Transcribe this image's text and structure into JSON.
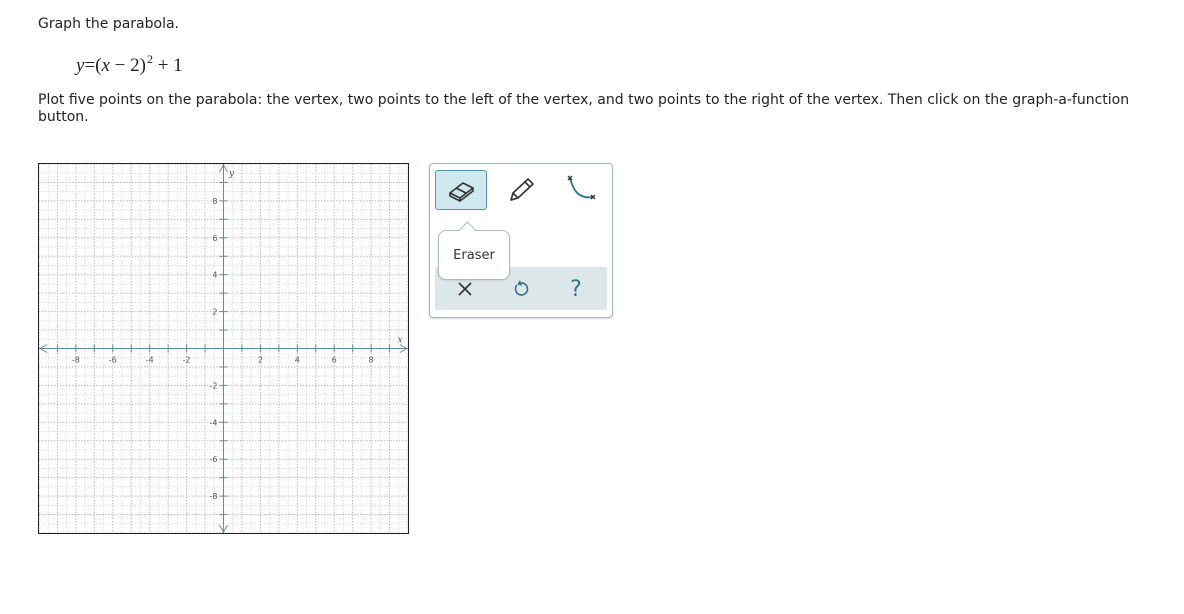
{
  "question": {
    "title": "Graph the parabola.",
    "equation": {
      "lhs": "y",
      "equals": "=",
      "open_paren": "(",
      "var": "x",
      "minus": " − 2",
      "close_paren": ")",
      "exponent": "2",
      "tail": " + 1"
    },
    "instructions": "Plot five points on the parabola: the vertex, two points to the left of the vertex, and two points to the right of the vertex. Then click on the graph-a-function button."
  },
  "graph": {
    "x_axis_label": "x",
    "y_axis_label": "y",
    "x_range": [
      -10,
      10
    ],
    "y_range": [
      -10,
      10
    ],
    "x_tick_labels": [
      "-8",
      "-6",
      "-4",
      "-2",
      "2",
      "4",
      "6",
      "8"
    ],
    "y_tick_labels": [
      "8",
      "6",
      "4",
      "2",
      "-2",
      "-4",
      "-6",
      "-8"
    ],
    "grid": true
  },
  "toolbar": {
    "tools": [
      {
        "name": "eraser-tool",
        "icon": "eraser-icon",
        "active": true
      },
      {
        "name": "pencil-tool",
        "icon": "pencil-icon",
        "active": false
      },
      {
        "name": "graph-function-tool",
        "icon": "curve-icon",
        "active": false
      }
    ],
    "tooltip": "Eraser",
    "actions": {
      "clear_icon": "x-icon",
      "undo_icon": "undo-icon",
      "help_label": "?"
    },
    "accent": "#2b7489",
    "active_bg": "#cfe7ee"
  }
}
